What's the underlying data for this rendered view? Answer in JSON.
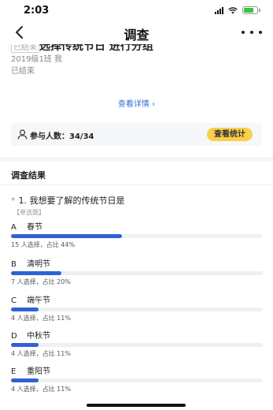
{
  "status_bar": {
    "time": "2:03",
    "battery_color": "#3cc23c"
  },
  "nav": {
    "title": "调查",
    "back_icon": "chevron-left-icon",
    "more_icon": "more-horizontal-icon"
  },
  "survey": {
    "tag": "已结束",
    "title": "选择传统节日 进行分组",
    "meta": "2019级1班 我",
    "status": "已结束",
    "detail_link": "查看详情 ›"
  },
  "participants": {
    "text": "参与人数：34/34",
    "icon": "person-icon",
    "stats_button": "查看统计",
    "button_color": "#f9cf4c"
  },
  "results": {
    "heading": "调查结果",
    "question": {
      "marker": "*",
      "title": "1. 我想要了解的传统节日是",
      "type": "【单选题】",
      "options": [
        {
          "letter": "A",
          "label": "春节",
          "count": 15,
          "percent": 44,
          "stat": "15 人选择，占比 44%"
        },
        {
          "letter": "B",
          "label": "清明节",
          "count": 7,
          "percent": 20,
          "stat": "7 人选择，占比 20%"
        },
        {
          "letter": "C",
          "label": "端午节",
          "count": 4,
          "percent": 11,
          "stat": "4 人选择，占比 11%"
        },
        {
          "letter": "D",
          "label": "中秋节",
          "count": 4,
          "percent": 11,
          "stat": "4 人选择，占比 11%"
        },
        {
          "letter": "E",
          "label": "重阳节",
          "count": 4,
          "percent": 11,
          "stat": "4 人选择，占比 11%"
        }
      ]
    },
    "bar_color": "#2f62d6"
  }
}
